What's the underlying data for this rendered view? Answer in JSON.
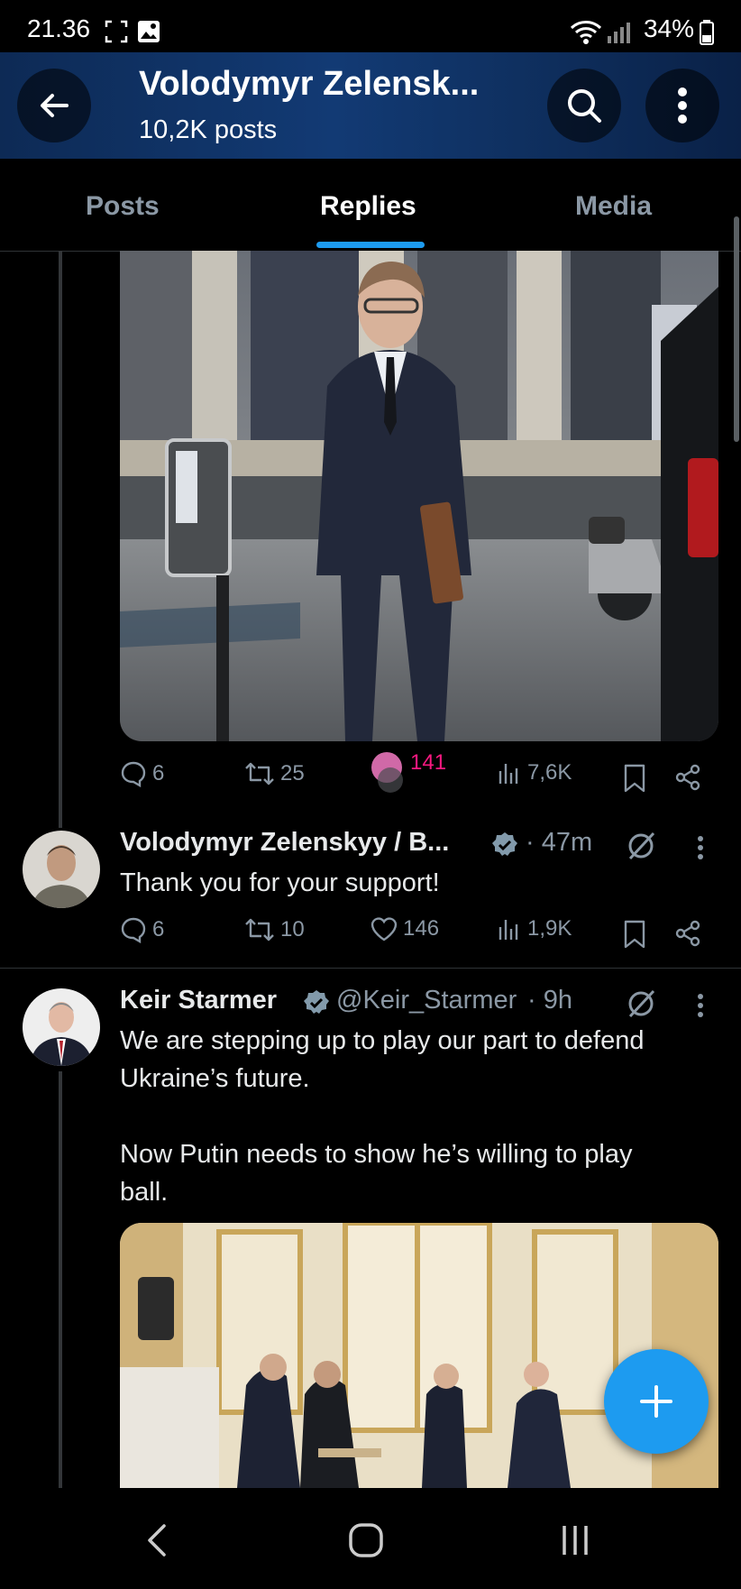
{
  "status_bar": {
    "time": "21.36",
    "battery": "34%"
  },
  "header": {
    "title": "Volodymyr Zelensk...",
    "subtitle": "10,2K posts"
  },
  "tabs": [
    {
      "label": "Posts"
    },
    {
      "label": "Replies"
    },
    {
      "label": "Media"
    }
  ],
  "post1_actions": {
    "replies": "6",
    "reposts": "25",
    "likes": "141",
    "views": "7,6K"
  },
  "reply_post": {
    "name": "Volodymyr Zelenskyy / B...",
    "time": "· 47m",
    "text": "Thank you for your support!",
    "actions": {
      "replies": "6",
      "reposts": "10",
      "likes": "146",
      "views": "1,9K"
    }
  },
  "starmer_post": {
    "name": "Keir Starmer",
    "handle": "@Keir_Starmer",
    "time": "· 9h",
    "text_line1": "We are stepping up to play our part to defend",
    "text_line2": "Ukraine’s future.",
    "text_line3": "Now Putin needs to show he’s willing to play",
    "text_line4": "ball."
  },
  "colors": {
    "accent": "#1d9bf0",
    "like_pink": "#f91880",
    "background": "#000000"
  }
}
